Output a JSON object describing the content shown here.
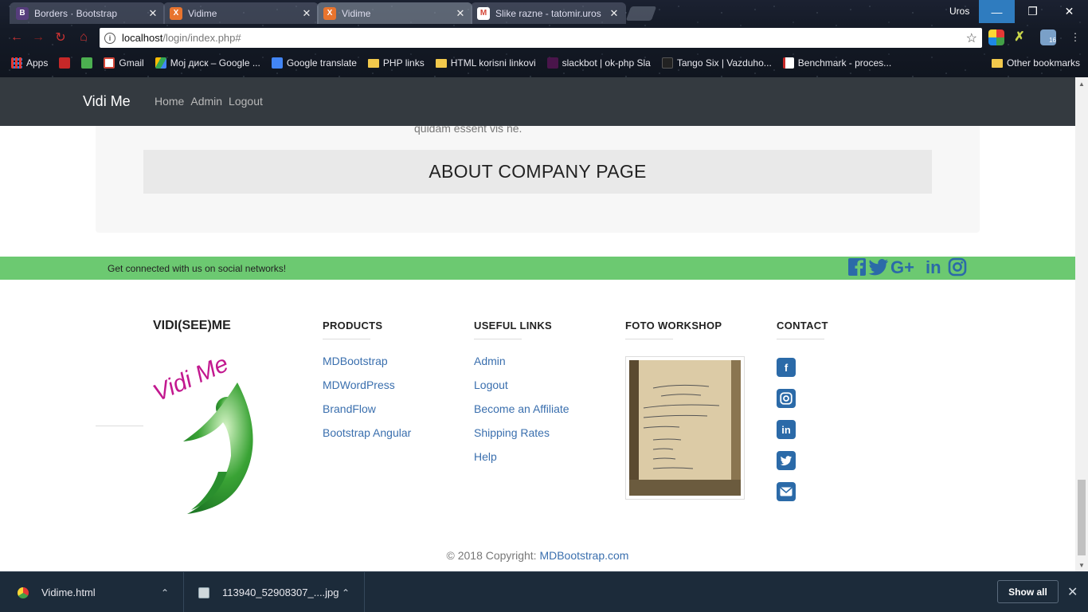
{
  "browser": {
    "tabs": [
      {
        "title": "Borders · Bootstrap",
        "favicon": "B",
        "favicon_color": "#563d7c"
      },
      {
        "title": "Vidime",
        "favicon": "X",
        "favicon_color": "#e8742e"
      },
      {
        "title": "Vidime",
        "favicon": "X",
        "favicon_color": "#e8742e"
      },
      {
        "title": "Slike razne - tatomir.uros",
        "favicon": "M",
        "favicon_color": "#d44638"
      }
    ],
    "profile": "Uros",
    "url_host": "localhost",
    "url_path": "/login/index.php#",
    "bookmarks": [
      {
        "label": "Apps",
        "icon": "apps-icon"
      },
      {
        "label": "",
        "icon": "pdf-icon"
      },
      {
        "label": "",
        "icon": "maps-icon"
      },
      {
        "label": "Gmail",
        "icon": "gmail-icon"
      },
      {
        "label": "Мој диск – Google ...",
        "icon": "drive-icon"
      },
      {
        "label": "Google translate",
        "icon": "translate-icon"
      },
      {
        "label": "PHP links",
        "icon": "folder-icon"
      },
      {
        "label": "HTML korisni linkovi",
        "icon": "folder-icon"
      },
      {
        "label": "slackbot | ok-php Sla",
        "icon": "slack-icon"
      },
      {
        "label": "Tango Six | Vazduho...",
        "icon": "tango-icon"
      },
      {
        "label": "Benchmark - proces...",
        "icon": "benchmark-icon"
      }
    ],
    "other_bookmarks": "Other bookmarks",
    "extension_badge": "16"
  },
  "site": {
    "brand": "Vidi Me",
    "nav": [
      "Home",
      "Admin",
      "Logout"
    ],
    "lorem_tail": "quidam essent vis ne.",
    "about_heading": "ABOUT COMPANY PAGE",
    "social_text": "Get connected with us on social networks!",
    "social_icons": [
      "facebook-icon",
      "twitter-icon",
      "google-plus-icon",
      "linkedin-icon",
      "instagram-icon"
    ],
    "footer": {
      "brand_title": "VIDI(SEE)ME",
      "logo_text": "Vidi Me",
      "products_head": "PRODUCTS",
      "products": [
        "MDBootstrap",
        "MDWordPress",
        "BrandFlow",
        "Bootstrap Angular"
      ],
      "useful_head": "USEFUL LINKS",
      "useful": [
        "Admin",
        "Logout",
        "Become an Affiliate",
        "Shipping Rates",
        "Help"
      ],
      "foto_head": "FOTO WORKSHOP",
      "contact_head": "CONTACT",
      "contact_icons": [
        "facebook-icon",
        "instagram-icon",
        "linkedin-icon",
        "twitter-icon",
        "envelope-icon"
      ],
      "copyright_prefix": "© 2018 Copyright: ",
      "copyright_link": "MDBootstrap.com"
    }
  },
  "downloads": {
    "items": [
      {
        "name": "Vidime.html",
        "icon": "chrome-icon"
      },
      {
        "name": "113940_52908307_....jpg",
        "icon": "image-file-icon"
      }
    ],
    "show_all": "Show all"
  },
  "colors": {
    "navbar": "#343a40",
    "social_bar": "#6cc971",
    "link": "#3a6fae",
    "social_icon": "#2b6aa8",
    "logo_green": "#3aa335",
    "logo_magenta": "#c2188f"
  }
}
